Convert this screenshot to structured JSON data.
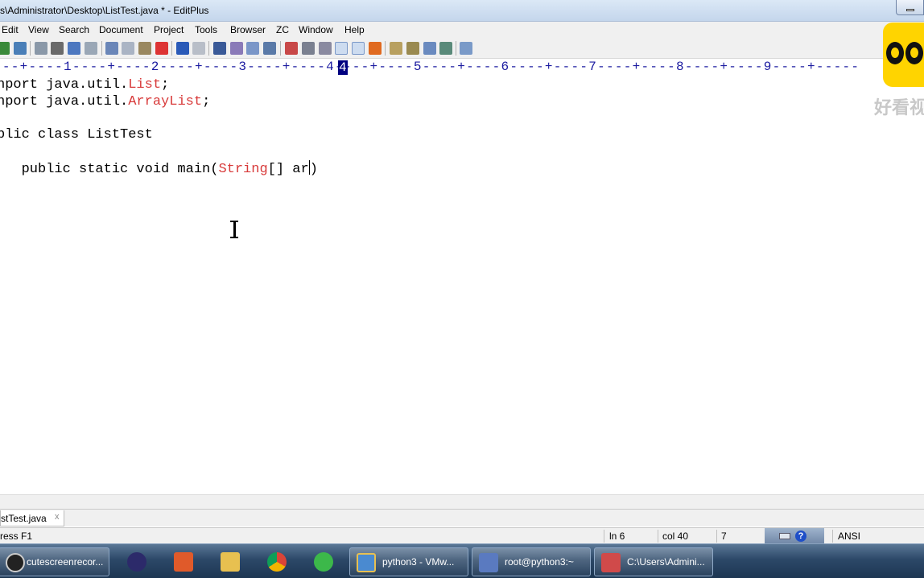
{
  "window": {
    "title": "s\\Administrator\\Desktop\\ListTest.java * - EditPlus"
  },
  "menu": [
    "Edit",
    "View",
    "Search",
    "Document",
    "Project",
    "Tools",
    "Browser",
    "ZC",
    "Window",
    "Help"
  ],
  "ruler": {
    "text": "---+----1----+----2----+----3----+----4----+----5----+----6----+----7----+----8----+----9----+-----",
    "current_column_marker": "4"
  },
  "code": {
    "line1_kw": "nport java.util.",
    "line1_type": "List",
    "line1_end": ";",
    "line2_kw": "nport java.util.",
    "line2_type": "ArrayList",
    "line2_end": ";",
    "line3": "blic class ListTest",
    "line4_pre": "   public static void main(",
    "line4_type": "String",
    "line4_post": "[] ar",
    "line4_after_caret": ")"
  },
  "tab": {
    "label": "stTest.java",
    "close": "x"
  },
  "status": {
    "help": "ress F1",
    "line": "ln 6",
    "col": "col 40",
    "extra": "7",
    "encoding": "ANSI"
  },
  "watermark": {
    "text": "好看视"
  },
  "taskbar": {
    "items": [
      {
        "label": "cutescreenrecor...",
        "icon": "film-reel-icon"
      },
      {
        "label": "",
        "icon": "eclipse-icon"
      },
      {
        "label": "",
        "icon": "hbuilder-icon"
      },
      {
        "label": "",
        "icon": "file-explorer-icon"
      },
      {
        "label": "",
        "icon": "chrome-icon"
      },
      {
        "label": "",
        "icon": "green-refresh-icon"
      },
      {
        "label": "python3 - VMw...",
        "icon": "vmware-icon"
      },
      {
        "label": "root@python3:~",
        "icon": "putty-icon"
      },
      {
        "label": "C:\\Users\\Admini...",
        "icon": "editplus-icon"
      }
    ]
  },
  "colors": {
    "type_highlight": "#d83a3a",
    "ruler_text": "#1a1aa0",
    "ruler_marker": "#000080",
    "watermark_logo": "#ffd400"
  }
}
